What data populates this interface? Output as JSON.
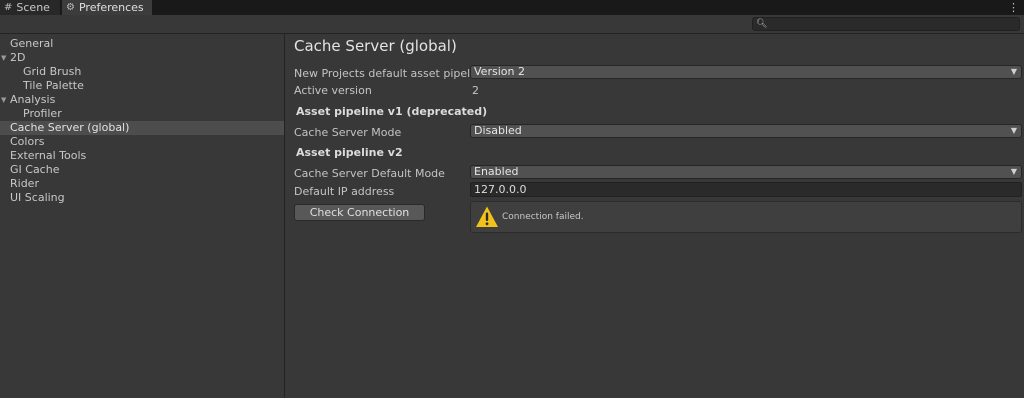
{
  "tabs": [
    {
      "label": "Scene",
      "icon": "grid-icon"
    },
    {
      "label": "Preferences",
      "icon": "gear-icon"
    }
  ],
  "sidebar": {
    "items": [
      {
        "label": "General"
      },
      {
        "label": "2D"
      },
      {
        "label": "Grid Brush"
      },
      {
        "label": "Tile Palette"
      },
      {
        "label": "Analysis"
      },
      {
        "label": "Profiler"
      },
      {
        "label": "Cache Server (global)"
      },
      {
        "label": "Colors"
      },
      {
        "label": "External Tools"
      },
      {
        "label": "GI Cache"
      },
      {
        "label": "Rider"
      },
      {
        "label": "UI Scaling"
      }
    ],
    "selected": "Cache Server (global)"
  },
  "main": {
    "title": "Cache Server (global)",
    "pipeline_label": "New Projects default asset pipeline",
    "pipeline_value": "Version 2",
    "active_version_label": "Active version",
    "active_version_value": "2",
    "section_v1": "Asset pipeline v1 (deprecated)",
    "cs_mode_label": "Cache Server Mode",
    "cs_mode_value": "Disabled",
    "section_v2": "Asset pipeline v2",
    "cs_default_mode_label": "Cache Server Default Mode",
    "cs_default_mode_value": "Enabled",
    "ip_label": "Default IP address",
    "ip_value": "127.0.0.0",
    "check_button": "Check Connection",
    "help_message": "Connection failed."
  },
  "colors": {
    "warning": "#f2c21b",
    "background": "#383838",
    "selected_row": "#4d4d4d"
  }
}
